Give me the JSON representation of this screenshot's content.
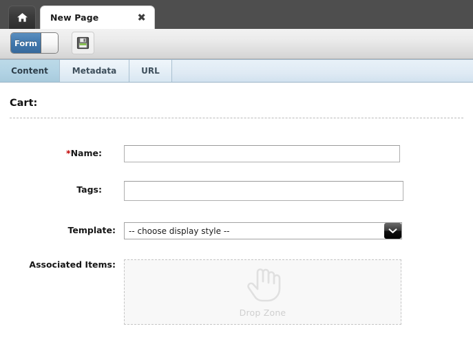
{
  "titlebar": {
    "home_icon": "home-icon",
    "tab_label": "New Page",
    "close_label": "✖"
  },
  "toolbar": {
    "toggle_label": "Form",
    "save_icon": "floppy-disk-save-icon"
  },
  "tabs": [
    {
      "label": "Content",
      "active": true
    },
    {
      "label": "Metadata",
      "active": false
    },
    {
      "label": "URL",
      "active": false
    }
  ],
  "form": {
    "section_title": "Cart:",
    "fields": {
      "name": {
        "label": "Name:",
        "required_marker": "*",
        "value": "",
        "placeholder": ""
      },
      "tags": {
        "label": "Tags:",
        "value": "",
        "placeholder": ""
      },
      "template": {
        "label": "Template:",
        "selected": "-- choose display style --",
        "arrow_icon": "chevron-down-icon"
      },
      "associated_items": {
        "label": "Associated Items:",
        "dropzone_label": "Drop Zone",
        "dropzone_icon": "pointing-hand-icon"
      }
    }
  },
  "colors": {
    "titlebar_bg": "#4e4e4e",
    "toggle_accent": "#4178ad",
    "tab_active_bg": "#b2d3e4",
    "required_star": "#c00000",
    "dropzone_text": "#cfcfcf"
  }
}
